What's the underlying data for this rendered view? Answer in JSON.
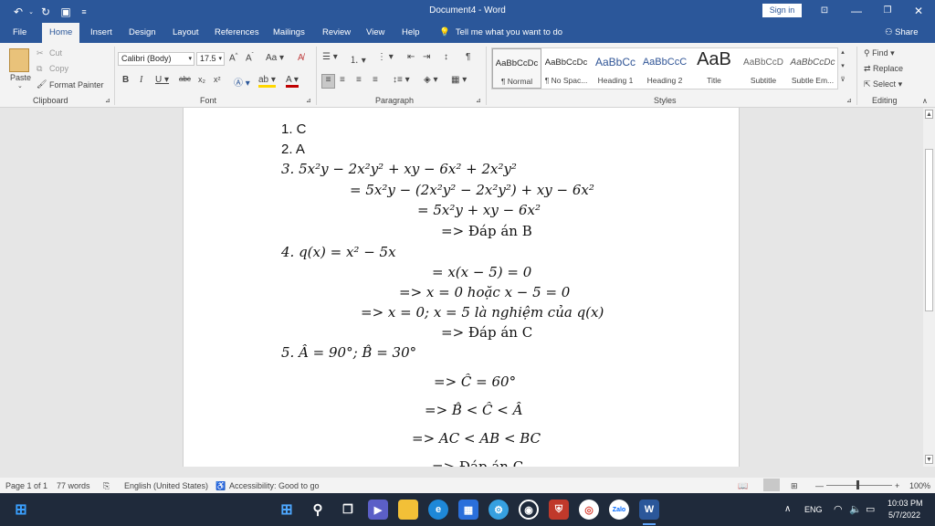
{
  "window": {
    "title": "Document4 - Word",
    "sign_in": "Sign in",
    "undo_icon": "undo-icon",
    "redo_icon": "redo-icon",
    "save_icon": "save-icon"
  },
  "tabs": [
    "File",
    "Home",
    "Insert",
    "Design",
    "Layout",
    "References",
    "Mailings",
    "Review",
    "View",
    "Help"
  ],
  "tell_me": "Tell me what you want to do",
  "share": "Share",
  "clipboard": {
    "paste": "Paste",
    "cut": "Cut",
    "copy": "Copy",
    "format_painter": "Format Painter",
    "label": "Clipboard"
  },
  "font": {
    "name": "Calibri (Body)",
    "size": "17.5",
    "change_case": "Aa",
    "label": "Font"
  },
  "paragraph": {
    "label": "Paragraph"
  },
  "styles": {
    "label": "Styles",
    "items": [
      {
        "preview": "AaBbCcDc",
        "name": "¶ Normal"
      },
      {
        "preview": "AaBbCcDc",
        "name": "¶ No Spac..."
      },
      {
        "preview": "AaBbCc",
        "name": "Heading 1"
      },
      {
        "preview": "AaBbCcC",
        "name": "Heading 2"
      },
      {
        "preview": "AaB",
        "name": "Title"
      },
      {
        "preview": "AaBbCcD",
        "name": "Subtitle"
      },
      {
        "preview": "AaBbCcDc",
        "name": "Subtle Em..."
      }
    ]
  },
  "editing": {
    "find": "Find",
    "replace": "Replace",
    "select": "Select",
    "label": "Editing"
  },
  "document": {
    "lines": [
      "1. C",
      "2. A",
      "3. 5x²y − 2x²y² + xy − 6x² + 2x²y²",
      "= 5x²y − (2x²y² − 2x²y²) + xy − 6x²",
      "= 5x²y + xy − 6x²",
      "=> Đáp án B",
      "4. q(x) = x² − 5x",
      "= x(x − 5) = 0",
      "=> x = 0 hoặc x − 5 = 0",
      "=> x = 0; x = 5 là nghiệm của q(x)",
      "=> Đáp án C",
      "5. Â = 90°; B̂ = 30°",
      "=> Ĉ = 60°",
      "=> B̂ < Ĉ < Â",
      "=> AC < AB < BC",
      "=> Đáp án C"
    ]
  },
  "status": {
    "page": "Page 1 of 1",
    "words": "77 words",
    "language": "English (United States)",
    "accessibility": "Accessibility: Good to go",
    "zoom": "100%"
  },
  "taskbar": {
    "lang": "ENG",
    "time": "10:03 PM",
    "date": "5/7/2022",
    "zalo": "Zalo"
  }
}
